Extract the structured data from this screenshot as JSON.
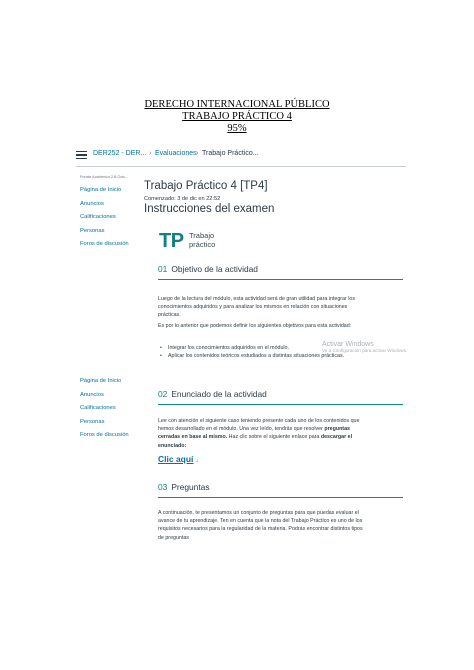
{
  "doc_header": {
    "line1": "DERECHO INTERNACIONAL PÚBLICO",
    "line2": "TRABAJO PRÁCTICO 4",
    "line3": "95%"
  },
  "topbar": {
    "course": "DER252 - DER...",
    "separator": "›",
    "section": "Evaluaciones",
    "current": "Trabajo Práctico..."
  },
  "sidebar": {
    "caption": "Portale Académico 2-B Octu...",
    "items": [
      "Página de Inicio",
      "Anuncios",
      "Calificaciones",
      "Personas",
      "Foros de discusión"
    ],
    "items_repeat": [
      "Página de Inicio",
      "Anuncios",
      "Calificaciones",
      "Personas",
      "Foros de discusión"
    ]
  },
  "main": {
    "title": "Trabajo Práctico 4 [TP4]",
    "started": "Comenzado: 3 de dic en 22:52",
    "instructions_heading": "Instrucciones del examen",
    "logo": {
      "tp": "TP",
      "word1": "Trabajo",
      "word2": "práctico"
    }
  },
  "section1": {
    "number": "01",
    "title": "Objetivo de la actividad",
    "para1": "Luego de la lectura del módulo, esta actividad será de gran utilidad para integrar los conocimientos adquiridos y para analizar los mismos en relación con situaciones prácticas.",
    "para2": "Es por lo anterior que podemos definir los siguientes objetivos para esta actividad:",
    "bullet1": "Integrar los conocimientos adquiridos en el módulo.",
    "bullet2": "Aplicar los contenidos teóricos estudiados a distintas situaciones prácticas."
  },
  "section2": {
    "number": "02",
    "title": "Enunciado de la actividad",
    "para_start": "Lee con atención el siguiente caso teniendo presente cada uno de los contenidos que hemos desarrollado en el módulo. Una vez leído, tendrás que resolver ",
    "para_bold1": "preguntas cerradas en base al mismo.",
    "para_mid": " Haz clic sobre el siguiente enlace para ",
    "para_bold2": "descargar el enunciado:",
    "link": "Clic aquí",
    "link_icon": "↓"
  },
  "section3": {
    "number": "03",
    "title": "Preguntas",
    "para": "A continuación, te presentamos un conjunto de preguntas para que puedas evaluar el avance de tu aprendizaje. Ten en cuenta que la nota del Trabajo Práctico es uno de los requisitos necesarios para la regularidad de la materia. Podrás encontrar distintos tipos de preguntas"
  },
  "watermark": {
    "line1": "Activar Windows",
    "line2": "Ve a Configuración para activar Windows."
  },
  "colors": {
    "teal": "#0f7f80",
    "link": "#0770a3",
    "text": "#2d3b45"
  }
}
